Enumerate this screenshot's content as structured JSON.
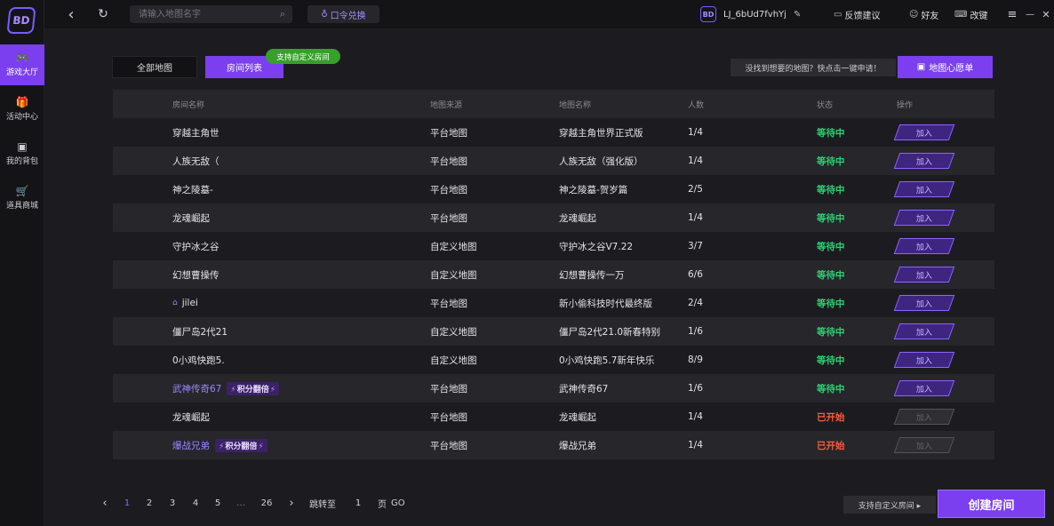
{
  "sidebar": {
    "logo": "BD",
    "items": [
      {
        "label": "游戏大厅",
        "icon": "gamepad-icon",
        "glyph": "🎮"
      },
      {
        "label": "活动中心",
        "icon": "gift-icon",
        "glyph": "🎁"
      },
      {
        "label": "我的背包",
        "icon": "bag-icon",
        "glyph": "▣"
      },
      {
        "label": "道具商城",
        "icon": "cart-icon",
        "glyph": "🛒"
      }
    ]
  },
  "topbar": {
    "back_glyph": "‹",
    "refresh_glyph": "↻",
    "search_placeholder": "请输入地图名字",
    "search_glyph": "⌕",
    "redeem_label": "口令兑换",
    "redeem_glyph": "♁",
    "avatar": "BD",
    "username": "LJ_6bUd7fvhYj",
    "edit_glyph": "✎",
    "feedback_label": "反馈建议",
    "friends_label": "好友",
    "rename_label": "改键",
    "menu_glyph": "≡",
    "minimize_glyph": "—",
    "close_glyph": "✕"
  },
  "tabs": {
    "all_maps": "全部地图",
    "room_list": "房间列表",
    "custom_tag": "支持自定义房间"
  },
  "wish": {
    "hint": "没找到想要的地图？快点击一键申请！",
    "button": "地图心愿单",
    "glyph": "▣"
  },
  "table": {
    "headers": {
      "name": "房间名称",
      "source": "地图来源",
      "map": "地图名称",
      "players": "人数",
      "status": "状态",
      "action": "操作"
    },
    "join_label": "加入",
    "rows": [
      {
        "name": "穿越主角世",
        "source": "平台地图",
        "map": "穿越主角世界正式版",
        "players": "1/4",
        "status": "等待中"
      },
      {
        "name": "人族无敌（",
        "source": "平台地图",
        "map": "人族无敌（强化版）",
        "players": "1/4",
        "status": "等待中"
      },
      {
        "name": "神之陵墓-",
        "source": "平台地图",
        "map": "神之陵墓-贺岁篇",
        "players": "2/5",
        "status": "等待中"
      },
      {
        "name": "龙魂崛起",
        "source": "平台地图",
        "map": "龙魂崛起",
        "players": "1/4",
        "status": "等待中"
      },
      {
        "name": "守护冰之谷",
        "source": "自定义地图",
        "map": "守护冰之谷V7.22",
        "players": "3/7",
        "status": "等待中"
      },
      {
        "name": "幻想曹操传",
        "source": "自定义地图",
        "map": "幻想曹操传一万",
        "players": "6/6",
        "status": "等待中"
      },
      {
        "name": "jilei",
        "source": "平台地图",
        "map": "新小偷科技时代最终版",
        "players": "2/4",
        "status": "等待中",
        "lock": "⌂"
      },
      {
        "name": "僵尸岛2代21",
        "source": "自定义地图",
        "map": "僵尸岛2代21.0新春特别",
        "players": "1/6",
        "status": "等待中"
      },
      {
        "name": "0小鸡快跑5.",
        "source": "自定义地图",
        "map": "0小鸡快跑5.7新年快乐",
        "players": "8/9",
        "status": "等待中"
      },
      {
        "name": "武神传奇67",
        "source": "平台地图",
        "map": "武神传奇67",
        "players": "1/6",
        "status": "等待中",
        "badge": "积分翻倍"
      },
      {
        "name": "龙魂崛起",
        "source": "平台地图",
        "map": "龙魂崛起",
        "players": "1/4",
        "status": "已开始"
      },
      {
        "name": "爆战兄弟",
        "source": "平台地图",
        "map": "爆战兄弟",
        "players": "1/4",
        "status": "已开始",
        "badge": "积分翻倍"
      }
    ]
  },
  "pagination": {
    "prev": "‹",
    "pages": [
      "1",
      "2",
      "3",
      "4",
      "5",
      "…",
      "26"
    ],
    "next": "›",
    "jump_label": "跳转至",
    "jump_value": "1",
    "page_label": "页",
    "go_label": "GO"
  },
  "bottom": {
    "custom_hint": "支持自定义房间 ▸",
    "create_button": "创建房间"
  }
}
